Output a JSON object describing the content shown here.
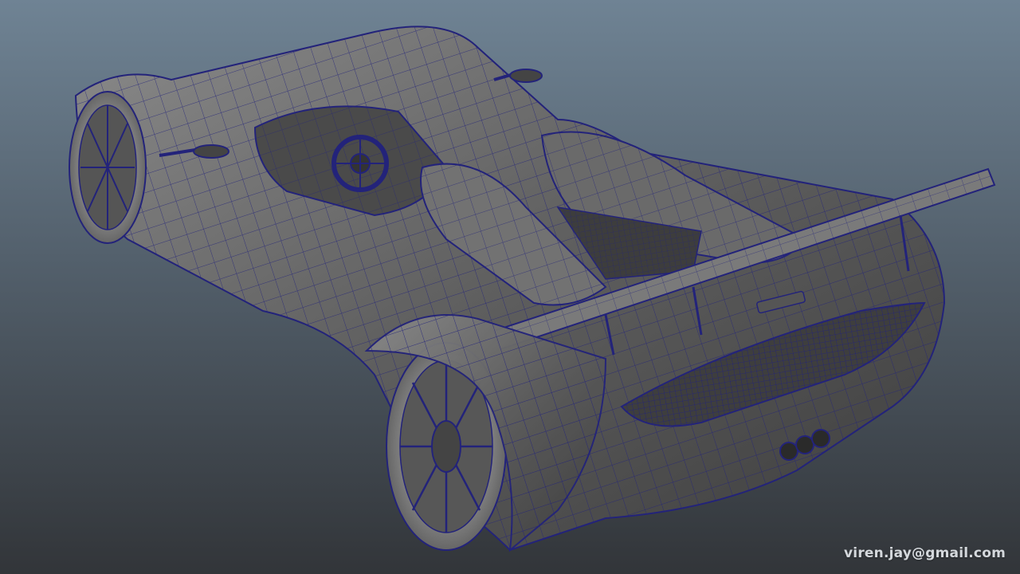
{
  "viewport": {
    "background_top": "#6f8394",
    "background_bottom": "#323539",
    "mesh_color": "#23237a",
    "surface_color": "#6c6c6c",
    "highlight_color": "#b9b9b9",
    "subject": "wireframe-car-model"
  },
  "watermark": {
    "text": "viren.jay@gmail.com"
  }
}
